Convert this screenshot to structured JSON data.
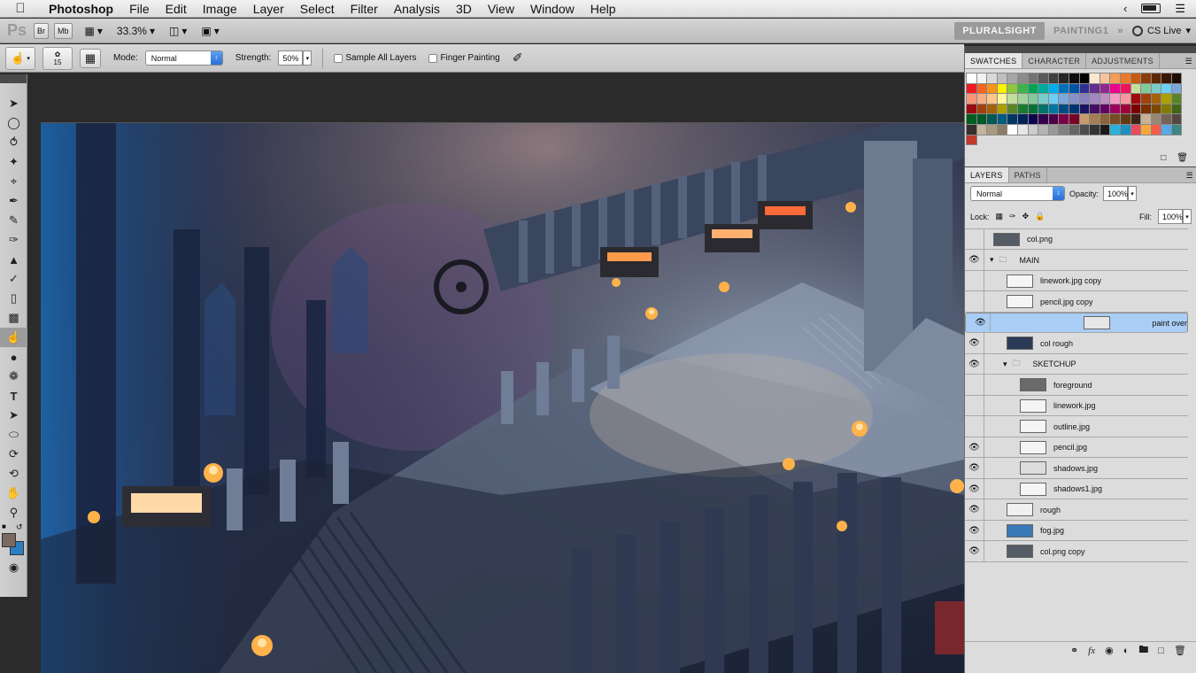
{
  "menubar": {
    "apple": "",
    "app_name": "Photoshop",
    "items": [
      "File",
      "Edit",
      "Image",
      "Layer",
      "Select",
      "Filter",
      "Analysis",
      "3D",
      "View",
      "Window",
      "Help"
    ]
  },
  "appbar": {
    "logo": "Ps",
    "br": "Br",
    "mb": "Mb",
    "zoom": "33.3%",
    "workspace_active": "PLURALSIGHT",
    "workspace_other": "PAINTING1",
    "more": "»",
    "cs_live": "CS Live"
  },
  "options": {
    "brush_size": "15",
    "mode_label": "Mode:",
    "mode_value": "Normal",
    "strength_label": "Strength:",
    "strength_value": "50%",
    "sample_all_layers": "Sample All Layers",
    "finger_painting": "Finger Painting"
  },
  "tools": [
    "move-tool",
    "marquee-tool",
    "lasso-tool",
    "quick-select-tool",
    "crop-tool",
    "eyedropper-tool",
    "spot-healing-tool",
    "brush-tool",
    "clone-stamp-tool",
    "history-brush-tool",
    "eraser-tool",
    "gradient-tool",
    "smudge-tool",
    "dodge-tool",
    "pen-tool",
    "type-tool",
    "path-select-tool",
    "shape-tool",
    "3d-rotate-tool",
    "3d-orbit-tool",
    "hand-tool",
    "zoom-tool"
  ],
  "colors": {
    "foreground": "#7a6a62",
    "background": "#2a7fc4",
    "selection": "#a9cdf4"
  },
  "swatches_panel": {
    "tabs": [
      "SWATCHES",
      "CHARACTER",
      "ADJUSTMENTS"
    ],
    "colors": [
      "#ffffff",
      "#f2f2f2",
      "#d9d9d9",
      "#bfbfbf",
      "#a6a6a6",
      "#8c8c8c",
      "#737373",
      "#595959",
      "#404040",
      "#262626",
      "#0d0d0d",
      "#000000",
      "#fbe7d1",
      "#f6c39a",
      "#f29b5a",
      "#ea7a2a",
      "#c65a10",
      "#8a3d0a",
      "#5c2808",
      "#3a1805",
      "#1f0d03",
      "#ed1c24",
      "#f26522",
      "#f7941d",
      "#fff200",
      "#8dc63f",
      "#39b54a",
      "#00a651",
      "#00a99d",
      "#00aeef",
      "#0072bc",
      "#0054a6",
      "#2e3192",
      "#662d91",
      "#92278f",
      "#ec008c",
      "#ed145b",
      "#c4df9b",
      "#82ca9c",
      "#7accc8",
      "#6dcff6",
      "#7da7d9",
      "#f7977a",
      "#f9ad81",
      "#fdc68a",
      "#fff79a",
      "#c4df9b",
      "#a3d39c",
      "#82ca9c",
      "#7accc8",
      "#6dcff6",
      "#7da7d9",
      "#8393ca",
      "#8781bd",
      "#a187be",
      "#bc8dbf",
      "#f49ac1",
      "#f6989d",
      "#9e0b0f",
      "#a0410d",
      "#a3620a",
      "#aba000",
      "#598527",
      "#9e0b0f",
      "#a0410d",
      "#a3620a",
      "#aba000",
      "#598527",
      "#1a7b30",
      "#007236",
      "#00746b",
      "#0076a3",
      "#004b80",
      "#003471",
      "#1b1464",
      "#440e62",
      "#630460",
      "#9e005d",
      "#9e0039",
      "#790000",
      "#7b2e00",
      "#7d4900",
      "#827b00",
      "#406618",
      "#005e20",
      "#005826",
      "#005952",
      "#005b7f",
      "#003663",
      "#002157",
      "#0d004c",
      "#32004b",
      "#4b0049",
      "#7b0046",
      "#7a0026",
      "#c69c6d",
      "#a67c52",
      "#8c6239",
      "#754c24",
      "#603913",
      "#3c2415",
      "#c7b299",
      "#998675",
      "#736357",
      "#534741",
      "#362f2d",
      "#c2b49b",
      "#a89a82",
      "#8c7d67",
      "#ffffff",
      "#e6e6e6",
      "#cccccc",
      "#b3b3b3",
      "#999999",
      "#808080",
      "#666666",
      "#4d4d4d",
      "#333333",
      "#1a1a1a",
      "#2bb0d9",
      "#1d8fc1",
      "#e84a5f",
      "#f7a541",
      "#f45d4c",
      "#5aa9e6",
      "#3b8686",
      "#c0392b"
    ]
  },
  "layers_panel": {
    "tabs": [
      "LAYERS",
      "PATHS"
    ],
    "blend_mode": "Normal",
    "opacity_label": "Opacity:",
    "opacity_value": "100%",
    "lock_label": "Lock:",
    "fill_label": "Fill:",
    "fill_value": "100%",
    "layers": [
      {
        "name": "col.png",
        "visible": false,
        "indent": 0,
        "type": "layer",
        "thumb": "#555c66"
      },
      {
        "name": "MAIN",
        "visible": true,
        "indent": 0,
        "type": "group",
        "expanded": true
      },
      {
        "name": "linework.jpg copy",
        "visible": false,
        "indent": 1,
        "type": "layer",
        "thumb": "#f5f5f5"
      },
      {
        "name": "pencil.jpg copy",
        "visible": false,
        "indent": 1,
        "type": "layer",
        "thumb": "#f5f5f5"
      },
      {
        "name": "paint over",
        "visible": true,
        "indent": 1,
        "type": "layer",
        "thumb": "#e7e7e7",
        "selected": true
      },
      {
        "name": "col rough",
        "visible": true,
        "indent": 1,
        "type": "layer",
        "thumb": "#2b3a55"
      },
      {
        "name": "SKETCHUP",
        "visible": true,
        "indent": 1,
        "type": "group",
        "expanded": true
      },
      {
        "name": "foreground",
        "visible": false,
        "indent": 2,
        "type": "layer",
        "thumb": "#6a6a6a"
      },
      {
        "name": "linework.jpg",
        "visible": false,
        "indent": 2,
        "type": "layer",
        "thumb": "#f5f5f5"
      },
      {
        "name": "outline.jpg",
        "visible": false,
        "indent": 2,
        "type": "layer",
        "thumb": "#f5f5f5"
      },
      {
        "name": "pencil.jpg",
        "visible": true,
        "indent": 2,
        "type": "layer",
        "thumb": "#f5f5f5"
      },
      {
        "name": "shadows.jpg",
        "visible": true,
        "indent": 2,
        "type": "layer",
        "thumb": "#dcdcdc"
      },
      {
        "name": "shadows1.jpg",
        "visible": true,
        "indent": 2,
        "type": "layer",
        "thumb": "#f5f5f5"
      },
      {
        "name": "rough",
        "visible": true,
        "indent": 1,
        "type": "layer",
        "thumb": "#f0f0f0"
      },
      {
        "name": "fog.jpg",
        "visible": true,
        "indent": 1,
        "type": "layer",
        "thumb": "#3b78b8"
      },
      {
        "name": "col.png copy",
        "visible": true,
        "indent": 1,
        "type": "layer",
        "thumb": "#555c66"
      }
    ],
    "footer_icons": [
      "link-icon",
      "fx-icon",
      "mask-icon",
      "adjustment-icon",
      "new-group-icon",
      "new-layer-icon",
      "trash-icon"
    ]
  }
}
